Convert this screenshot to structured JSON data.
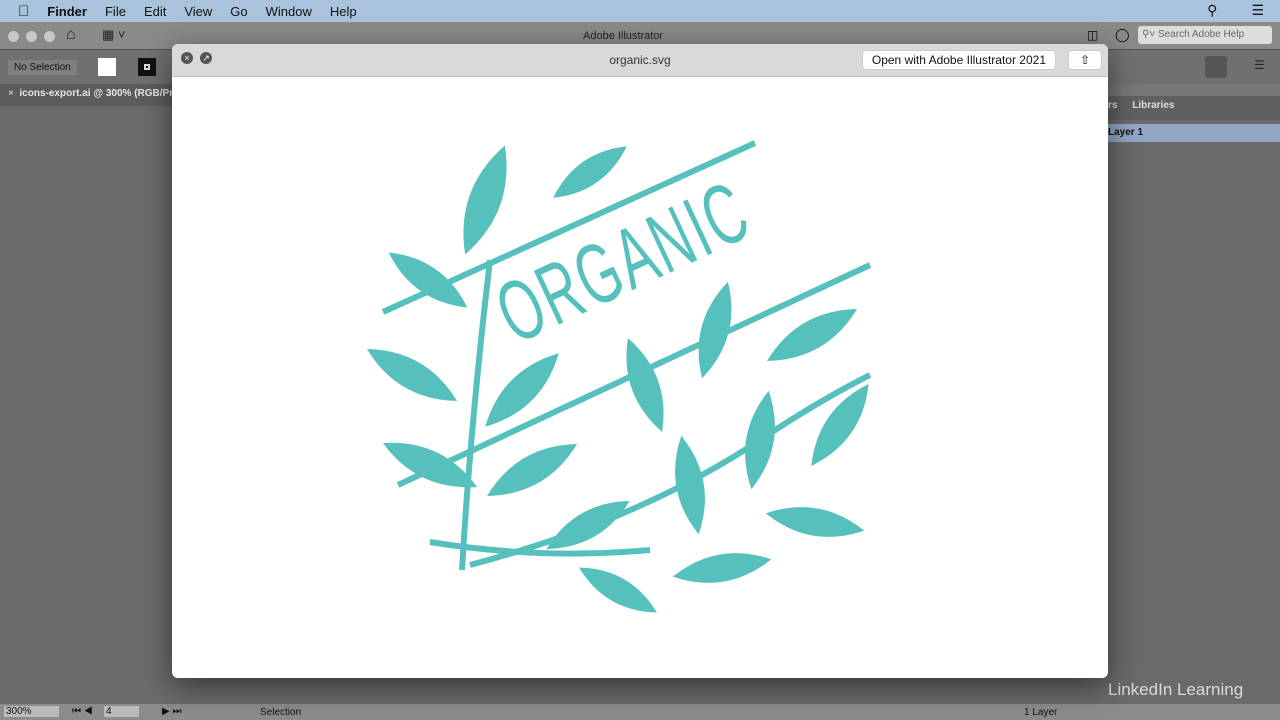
{
  "menubar": {
    "app": "Finder",
    "items": [
      "File",
      "Edit",
      "View",
      "Go",
      "Window",
      "Help"
    ]
  },
  "illustrator": {
    "title": "Adobe Illustrator",
    "selection": "No Selection",
    "doc_tab": "icons-export.ai @ 300% (RGB/Pre",
    "search_placeholder": "Search Adobe Help",
    "panel_tabs": [
      "rs",
      "Libraries"
    ],
    "layer": "Layer 1",
    "layer_count": "1 Layer",
    "zoom": "300%",
    "artboard": "4",
    "tool": "Selection"
  },
  "quicklook": {
    "filename": "organic.svg",
    "open_button": "Open with Adobe Illustrator 2021",
    "artwork_text": "ORGANIC",
    "art_color": "#56c1bc"
  },
  "branding": {
    "watermark": "LinkedIn Learning"
  }
}
